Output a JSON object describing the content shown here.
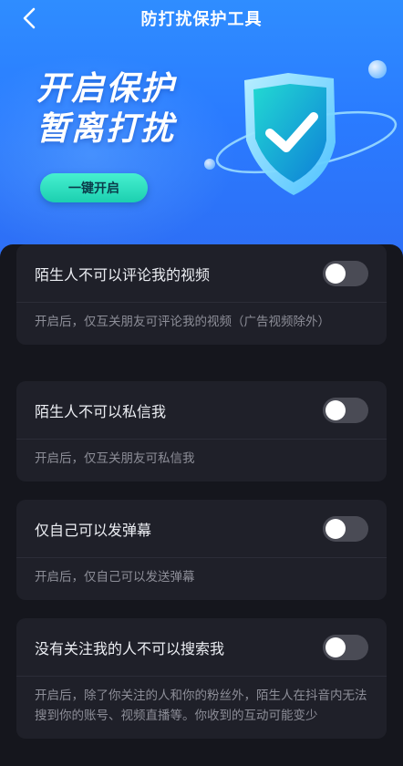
{
  "header": {
    "title": "防打扰保护工具",
    "back_icon": "chevron-left-icon"
  },
  "hero": {
    "slogan_line1": "开启保护",
    "slogan_line2": "暂离打扰",
    "enable_button": "一键开启",
    "shield_icon": "shield-check-icon"
  },
  "settings": [
    {
      "title": "陌生人不可以评论我的视频",
      "enabled": false,
      "description": "开启后，仅互关朋友可评论我的视频（广告视频除外）"
    },
    {
      "title": "陌生人不可以私信我",
      "enabled": false,
      "description": "开启后，仅互关朋友可私信我"
    },
    {
      "title": "仅自己可以发弹幕",
      "enabled": false,
      "description": "开启后，仅自己可以发送弹幕"
    },
    {
      "title": "没有关注我的人不可以搜索我",
      "enabled": false,
      "description": "开启后，除了你关注的人和你的粉丝外，陌生人在抖音内无法搜到你的账号、视频直播等。你收到的互动可能变少"
    }
  ],
  "colors": {
    "hero_blue": "#2f8dff",
    "accent_teal": "#1ccfb0",
    "background": "#15161d",
    "card": "#1f2029",
    "toggle_off": "#4a4b55"
  }
}
